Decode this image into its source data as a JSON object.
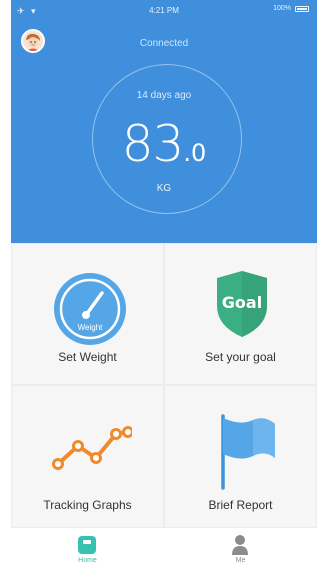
{
  "status_bar": {
    "left": "✈ ▾",
    "time": "4:21 PM",
    "battery_text": "100%"
  },
  "header": {
    "connection_status": "Connected",
    "last_measured": "14 days ago",
    "weight_integer": "83",
    "weight_decimal": ".0",
    "unit": "KG"
  },
  "tiles": [
    {
      "label": "Set Weight",
      "icon": "gauge-icon",
      "icon_text": "Weight"
    },
    {
      "label": "Set your goal",
      "icon": "goal-shield-icon",
      "icon_text": "Goal"
    },
    {
      "label": "Tracking Graphs",
      "icon": "line-graph-icon"
    },
    {
      "label": "Brief Report",
      "icon": "flag-icon"
    }
  ],
  "tabbar": {
    "tabs": [
      {
        "label": "Home",
        "icon": "scale-icon",
        "active": true
      },
      {
        "label": "Me",
        "icon": "person-icon",
        "active": false
      }
    ]
  },
  "colors": {
    "header_blue": "#3f8fdc",
    "accent_teal": "#36c1b0",
    "goal_green": "#3cae84",
    "graph_orange": "#f08a2e",
    "flag_blue": "#55a6e6"
  }
}
